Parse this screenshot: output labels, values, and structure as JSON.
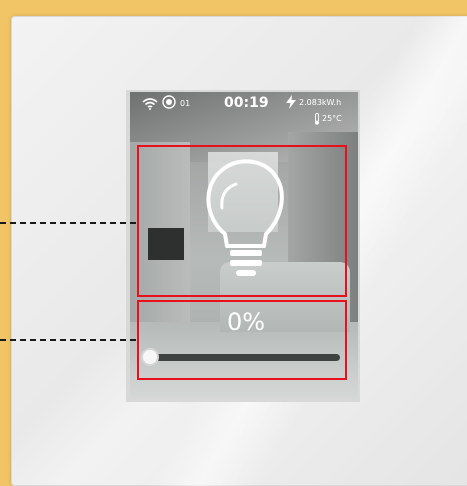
{
  "status_bar": {
    "recording_label": "01",
    "time": "00:19",
    "energy": "2.083kW.h",
    "temperature": "25°C"
  },
  "dimmer": {
    "level_percent": 0,
    "level_label": "0%"
  },
  "icons": {
    "wifi": "wifi-icon",
    "recording": "record-icon",
    "power": "lightning-bolt-icon",
    "temperature": "thermometer-icon",
    "light": "light-bulb-icon"
  },
  "colors": {
    "frame_background": "#f1c565",
    "highlight_box": "#e8101c",
    "slider_track": "#3e4342",
    "text": "#ffffff"
  }
}
